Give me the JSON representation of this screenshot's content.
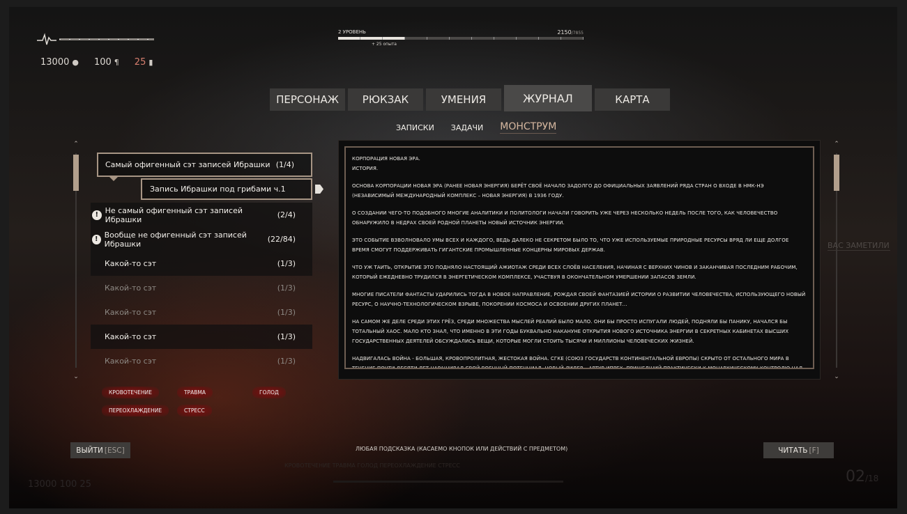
{
  "hud": {
    "water": "13000",
    "water_icon": "drop-icon",
    "food": "100",
    "food_icon": "fork-knife-icon",
    "ammo": "25",
    "ammo_icon": "bottle-icon",
    "accent_red": "#d87f6f"
  },
  "xp": {
    "level_label": "2 УРОВЕНЬ",
    "current": "2150",
    "max": "/7855",
    "gain": "+ 25 опыта",
    "progress_fraction": 0.27
  },
  "tabs": [
    {
      "label": "ПЕРСОНАЖ",
      "active": false
    },
    {
      "label": "РЮКЗАК",
      "active": false
    },
    {
      "label": "УМЕНИЯ",
      "active": false
    },
    {
      "label": "ЖУРНАЛ",
      "active": true
    },
    {
      "label": "КАРТА",
      "active": false
    }
  ],
  "subtabs": [
    {
      "label": "ЗАПИСКИ",
      "active": false
    },
    {
      "label": "ЗАДАЧИ",
      "active": false
    },
    {
      "label": "МОНСТРУМ",
      "active": true
    }
  ],
  "list": [
    {
      "title": "Самый офигенный сэт записей Ибрашки",
      "count": "(1/4)",
      "style": "sel"
    },
    {
      "title": "Запись Ибрашки под грибами ч.1",
      "count": "",
      "style": "child"
    },
    {
      "title": "Не самый офигенный сэт записей Ибрашки",
      "count": "(2/4)",
      "style": "dark",
      "warn": true
    },
    {
      "title": "Вообще не офигенный сэт записей Ибрашки",
      "count": "(22/84)",
      "style": "dark",
      "warn": true
    },
    {
      "title": "Какой-то сэт",
      "count": "(1/3)",
      "style": "dark"
    },
    {
      "title": "Какой-то сэт",
      "count": "(1/3)",
      "style": "dim"
    },
    {
      "title": "Какой-то сэт",
      "count": "(1/3)",
      "style": "dim"
    },
    {
      "title": "Какой-то сэт",
      "count": "(1/3)",
      "style": "dark"
    },
    {
      "title": "Какой-то сэт",
      "count": "(1/3)",
      "style": "dim"
    }
  ],
  "article": {
    "heading1": "КОРПОРАЦИЯ НОВАЯ ЭРА.",
    "heading2": "ИСТОРИЯ.",
    "paragraphs": [
      "ОСНОВА КОРПОРАЦИИ НОВАЯ ЭРА (РАНЕЕ НОВАЯ ЭНЕРГИЯ) БЕРЁТ СВОЁ НАЧАЛО ЗАДОЛГО ДО ОФИЦИАЛЬНЫХ ЗАЯВЛЕНИЙ РЯДА СТРАН О ВХОДЕ В НМК-НЭ (НЕЗАВИСИМЫЙ МЕЖДУНАРОДНЫЙ КОМПЛЕКС – НОВАЯ ЭНЕРГИЯ) В 1936 ГОДУ.",
      "О СОЗДАНИИ ЧЕГО-ТО ПОДОБНОГО МНОГИЕ АНАЛИТИКИ И ПОЛИТОЛОГИ НАЧАЛИ ГОВОРИТЬ УЖЕ ЧЕРЕЗ НЕСКОЛЬКО НЕДЕЛЬ ПОСЛЕ ТОГО, КАК ЧЕЛОВЕЧЕСТВО ОБНАРУЖИЛО В НЕДРАХ СВОЕЙ РОДНОЙ ПЛАНЕТЫ НОВЫЙ ИСТОЧНИК ЭНЕРГИИ.",
      "ЭТО СОБЫТИЕ ВЗВОЛНОВАЛО УМЫ ВСЕХ И КАЖДОГО, ВЕДЬ ДАЛЕКО НЕ СЕКРЕТОМ БЫЛО ТО, ЧТО УЖЕ ИСПОЛЬЗУЕМЫЕ ПРИРОДНЫЕ РЕСУРСЫ ВРЯД ЛИ ЕЩЕ ДОЛГОЕ ВРЕМЯ СМОГУТ ПОДДЕРЖИВАТЬ ГИГАНТСКИЕ ПРОМЫШЛЕННЫЕ КОНЦЕРНЫ МИРОВЫХ ДЕРЖАВ.",
      "ЧТО УЖ ТАИТЬ, ОТКРЫТИЕ ЭТО ПОДНЯЛО НАСТОЯЩИЙ АЖИОТАЖ СРЕДИ ВСЕХ СЛОЁВ НАСЕЛЕНИЯ, НАЧИНАЯ С ВЕРХНИХ ЧИНОВ И ЗАКАНЧИВАЯ ПОСЛЕДНИМ РАБОЧИМ, КОТОРЫЙ ЕЖЕДНЕВНО ТРУДИЛСЯ В ЭНЕРГЕТИЧЕСКОМ КОМПЛЕКСЕ, УЧАСТВУЯ В ОКОНЧАТЕЛЬНОМ УМЕРШЕНИИ ЗАПАСОВ ЗЕМЛИ.",
      "МНОГИЕ ПИСАТЕЛИ ФАНТАСТЫ УДАРИЛИСЬ ТОГДА В НОВОЕ НАПРАВЛЕНИЕ, РОЖДАЯ СВОЕЙ ФАНТАЗИЕЙ ИСТОРИИ О РАЗВИТИИ ЧЕЛОВЕЧЕСТВА, ИСПОЛЬЗУЮЩЕГО НОВЫЙ РЕСУРС, О НАУЧНО-ТЕХНОЛОГИЧЕСКОМ ВЗРЫВЕ, ПОКОРЕНИИ КОСМОСА И ОСВОЕНИИ ДРУГИХ ПЛАНЕТ...",
      "НА САМОМ ЖЕ ДЕЛЕ СРЕДИ ЭТИХ ГРЁЗ, СРЕДИ МНОЖЕСТВА МЫСЛЕЙ РЕАЛИЙ БЫЛО МАЛО. ОНИ БЫ ПРОСТО ИСПУГАЛИ ЛЮДЕЙ, ПОДНЯЛИ БЫ ПАНИКУ, НАЧАЛСЯ БЫ ТОТАЛЬНЫЙ ХАОС. МАЛО КТО ЗНАЛ, ЧТО ИМЕННО В ЭТИ ГОДЫ БУКВАЛЬНО НАКАНУНЕ ОТКРЫТИЯ НОВОГО ИСТОЧНИКА ЭНЕРГИИ В СЕКРЕТНЫХ КАБИНЕТАХ ВЫСШИХ ГОСУДАРСТВЕННЫХ ДЕЯТЕЛЕЙ ОБСУЖДАЛИСЬ ВЕЩИ, КОТОРЫЕ МОГЛИ СТОИТЬ ТЫСЯЧИ И МИЛЛИОНЫ ЧЕЛОВЕЧЕСКИХ ЖИЗНЕЙ.",
      "НАДВИГАЛАСЬ ВОЙНА - БОЛЬШАЯ, КРОВОПРОЛИТНАЯ, ЖЕСТОКАЯ ВОЙНА. СГКЕ (СОЮЗ ГОСУДАРСТВ КОНТИНЕНТАЛЬНОЙ ЕВРОПЫ) СКРЫТО ОТ ОСТАЛЬНОГО МИРА В ТЕЧЕНИЕ ПОЧТИ ДЕСЯТИ ЛЕТ НАРАЩИВАЛ СВОЙ ВОЕННЫЙ ПОТЕНЦИАЛ. НОВЫЙ ЛИДЕР – АРТУР ИПРЕХ, ПРИШЕДШИЙ ПРАКТИЧЕСКИ К МОНАРХИЧЕСКОМУ КОНТРОЛЮ НАД МНОГОМИЛЛИОННЫМ НАСЕЛЕНИЕМ, ЖЕЛАЛ"
    ]
  },
  "ghost_notice": "ВАС ЗАМЕТИЛИ",
  "effects": [
    {
      "label": "КРОВОТЕЧЕНИЕ"
    },
    {
      "label": "ТРАВМА"
    },
    {
      "label": "ГОЛОД"
    },
    {
      "label": "ПЕРЕОХЛАЖДЕНИЕ"
    },
    {
      "label": "СТРЕСС"
    }
  ],
  "footer": {
    "exit_label": "ВЫЙТИ",
    "exit_key": "[ESC]",
    "hint": "ЛЮБАЯ ПОДСКАЗКА (КАСАЕМО КНОПОК ИЛИ ДЕЙСТВИЙ С ПРЕДМЕТОМ)",
    "read_label": "ЧИТАТЬ",
    "read_key": "[F]"
  },
  "background_ghost": {
    "effects_row": "КРОВОТЕЧЕНИЕ          ТРАВМА          ГОЛОД          ПЕРЕОХЛАЖДЕНИЕ          СТРЕСС",
    "hud_row": "13000        100        25",
    "counter": "02",
    "counter_total": "/18"
  }
}
